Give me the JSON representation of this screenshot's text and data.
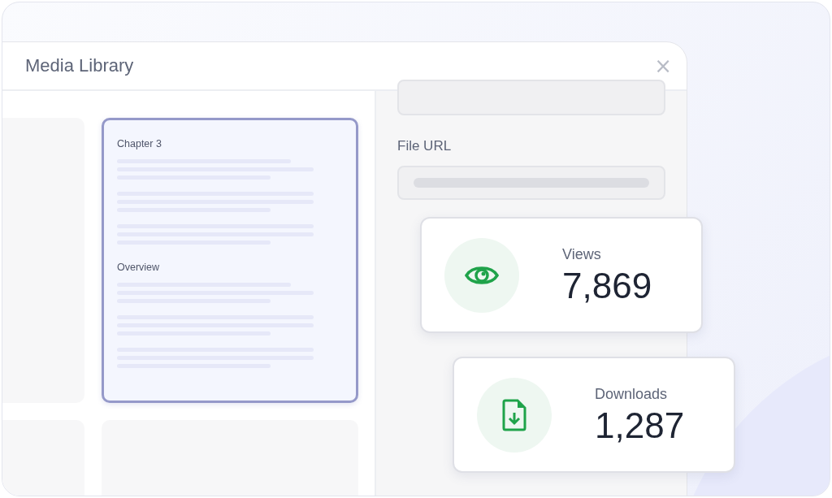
{
  "window": {
    "title": "Media Library",
    "close": "×"
  },
  "tiles": [
    {
      "kind": "blank",
      "selected": false
    },
    {
      "kind": "document",
      "selected": true,
      "sections": [
        {
          "heading": "Chapter 3"
        },
        {
          "heading": "Overview"
        }
      ]
    },
    {
      "kind": "blank",
      "selected": false
    },
    {
      "kind": "blank",
      "selected": false
    }
  ],
  "details": {
    "fields": [
      {
        "kind": "empty"
      },
      {
        "kind": "filled",
        "label": "File URL"
      }
    ]
  },
  "stats": [
    {
      "kind": "views",
      "label": "Views",
      "value": "7,869"
    },
    {
      "kind": "downloads",
      "label": "Downloads",
      "value": "1,287"
    }
  ]
}
